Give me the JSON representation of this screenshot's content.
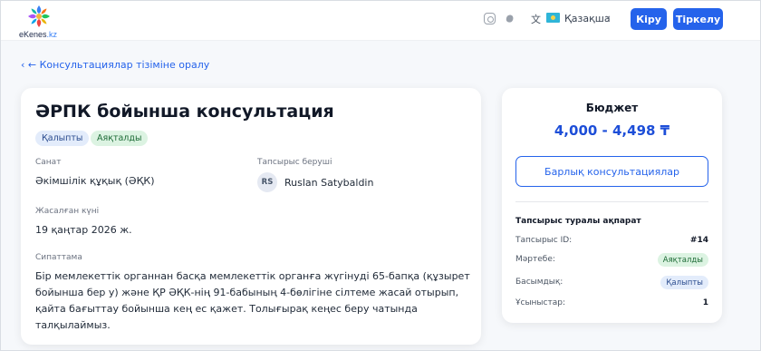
{
  "header": {
    "logo_text_main": "eKenes",
    "logo_text_suffix": ".kz",
    "language": "Қазақша",
    "login_label": "Кіру",
    "register_label": "Тіркелу",
    "icons": [
      "instagram-icon",
      "threads-icon",
      "translate-icon",
      "flag-kz-icon",
      "chevron-down-icon"
    ]
  },
  "back_link": "‹  ← Консультациялар тізіміне оралу",
  "consultation": {
    "title": "ӘРПК бойынша консультация",
    "badges": [
      "Қалыпты",
      "Аяқталды"
    ],
    "category_label": "Санат",
    "category_value": "Әкімшілік құқық (ӘҚК)",
    "client_label": "Тапсырыс беруші",
    "client_initials": "RS",
    "client_name": "Ruslan Satybaldin",
    "created_label": "Жасалған күні",
    "created_value": "19 қаңтар 2026 ж.",
    "description_label": "Сипаттама",
    "description": "Бір мемлекеттік органнан басқа мемлекеттік органға жүгінуді 65-бапқа (құзырет бойынша бер у) және ҚР ӘҚК-нің 91-бабының 4-бөлігіне сілтеме жасай отырып, қайта бағыттау бойынша кең ес қажет. Толығырақ кеңес беру чатында талқылаймыз."
  },
  "sidebar": {
    "budget_title": "Бюджет",
    "budget_value": "4,000 - 4,498 ₸",
    "all_button": "Барлық консультациялар",
    "info_title": "Тапсырыс туралы ақпарат",
    "rows": [
      {
        "key": "Тапсырыс ID:",
        "value": "#14"
      },
      {
        "key": "Мәртебе:",
        "value": "Аяқталды"
      },
      {
        "key": "Басымдық:",
        "value": "Қалыпты"
      },
      {
        "key": "Ұсыныстар:",
        "value": "1"
      }
    ]
  },
  "colors": {
    "accent": "#2563eb",
    "badge_normal_bg": "#e3ecfb",
    "badge_done_bg": "#dcf3e2"
  }
}
